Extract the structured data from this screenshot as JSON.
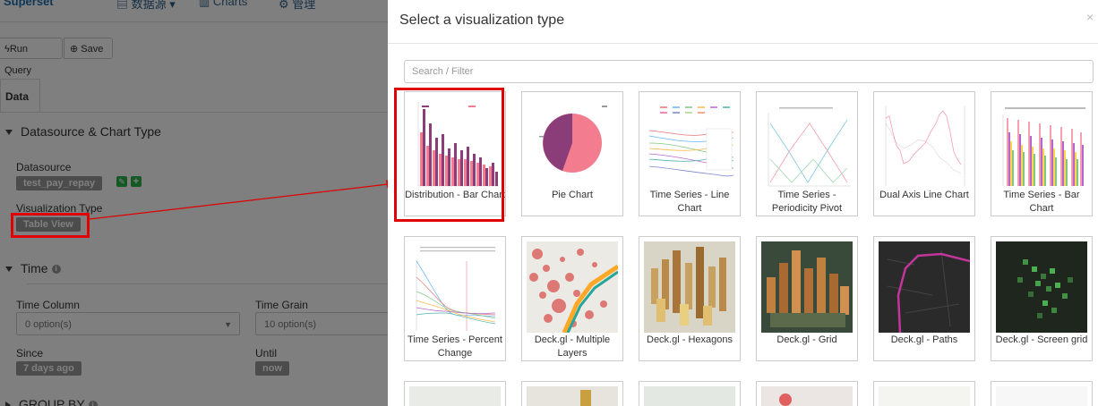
{
  "topbar": {
    "datasources_label": "数据源",
    "charts_label": "Charts",
    "settings_label": "管理"
  },
  "toolbar": {
    "run_label": "Run Query",
    "save_label": "Save"
  },
  "tabs": {
    "data_label": "Data"
  },
  "sections": {
    "datasource_chart_type": {
      "title": "Datasource & Chart Type",
      "datasource_label": "Datasource",
      "datasource_value": "test_pay_repay",
      "viz_type_label": "Visualization Type",
      "viz_type_value": "Table View"
    },
    "time": {
      "title": "Time",
      "time_column_label": "Time Column",
      "time_column_value": "0 option(s)",
      "time_grain_label": "Time Grain",
      "time_grain_value": "10 option(s)",
      "since_label": "Since",
      "since_value": "7 days ago",
      "until_label": "Until",
      "until_value": "now"
    },
    "group_by": {
      "title": "GROUP BY"
    }
  },
  "modal": {
    "title": "Select a visualization type",
    "close": "×",
    "filter_placeholder": "Search / Filter",
    "viz_types": [
      {
        "label": "Distribution - Bar Chart",
        "selected": true
      },
      {
        "label": "Pie Chart"
      },
      {
        "label": "Time Series - Line Chart"
      },
      {
        "label": "Time Series - Periodicity Pivot"
      },
      {
        "label": "Dual Axis Line Chart"
      },
      {
        "label": "Time Series - Bar Chart"
      },
      {
        "label": "Time Series - Percent Change"
      },
      {
        "label": "Deck.gl - Multiple Layers"
      },
      {
        "label": "Deck.gl - Hexagons"
      },
      {
        "label": "Deck.gl - Grid"
      },
      {
        "label": "Deck.gl - Paths"
      },
      {
        "label": "Deck.gl - Screen grid"
      }
    ]
  },
  "colors": {
    "annotation_red": "#e00000",
    "bar_purple": "#8b3d7a",
    "bar_pink": "#f47c8f",
    "deck_red": "#d9534f"
  }
}
